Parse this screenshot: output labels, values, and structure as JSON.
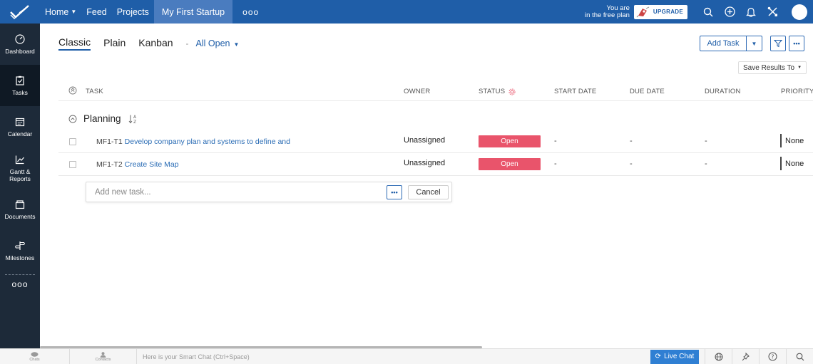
{
  "topbar": {
    "nav": [
      {
        "label": "Home",
        "has_caret": true
      },
      {
        "label": "Feed"
      },
      {
        "label": "Projects"
      },
      {
        "label": "My First Startup",
        "active": true
      }
    ],
    "more_label": "ooo",
    "plan_line1": "You are",
    "plan_line2": "in the free plan",
    "upgrade_label": "UPGRADE",
    "icons": [
      "search-icon",
      "add-icon",
      "bell-icon",
      "tools-icon"
    ]
  },
  "sidebar": {
    "items": [
      {
        "label": "Dashboard",
        "icon": "dashboard-icon"
      },
      {
        "label": "Tasks",
        "icon": "tasks-icon",
        "active": true
      },
      {
        "label": "Calendar",
        "icon": "calendar-icon"
      },
      {
        "label": "Gantt &",
        "label2": "Reports",
        "icon": "chart-icon"
      },
      {
        "label": "Documents",
        "icon": "documents-icon"
      },
      {
        "label": "Milestones",
        "icon": "milestone-icon"
      }
    ],
    "more_label": "ooo"
  },
  "views": {
    "tabs": [
      "Classic",
      "Plain",
      "Kanban"
    ],
    "active": "Classic",
    "separator": "-",
    "filter": "All Open"
  },
  "actions": {
    "add_task": "Add Task",
    "save_results": "Save Results To"
  },
  "columns": {
    "task": "TASK",
    "owner": "OWNER",
    "status": "STATUS",
    "start_date": "START DATE",
    "due_date": "DUE DATE",
    "duration": "DURATION",
    "priority": "PRIORITY"
  },
  "group": {
    "name": "Planning"
  },
  "tasks": [
    {
      "id": "MF1-T1",
      "name": "Develop company plan and systems to define and",
      "owner": "Unassigned",
      "status": "Open",
      "start": "-",
      "due": "-",
      "duration": "-",
      "priority": "None"
    },
    {
      "id": "MF1-T2",
      "name": "Create Site Map",
      "owner": "Unassigned",
      "status": "Open",
      "start": "-",
      "due": "-",
      "duration": "-",
      "priority": "None"
    }
  ],
  "new_task": {
    "placeholder": "Add new task...",
    "cancel": "Cancel"
  },
  "bottombar": {
    "chats": "Chats",
    "contacts": "Contacts",
    "smart_chat": "Here is your Smart Chat (Ctrl+Space)",
    "live_chat": "Live Chat"
  },
  "colors": {
    "topbar": "#1f5ea8",
    "sidebar": "#1d2a39",
    "status_open": "#e9546b",
    "link": "#2a6cb5"
  }
}
